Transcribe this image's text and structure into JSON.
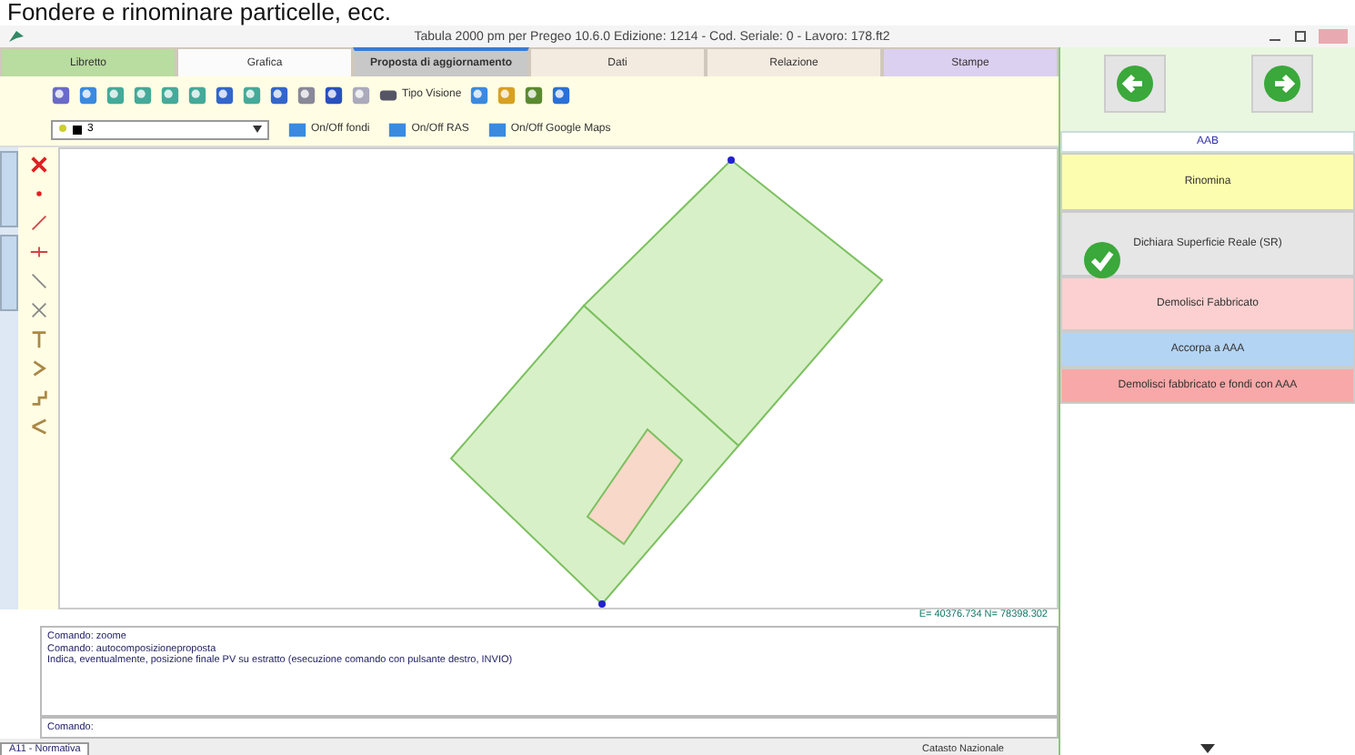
{
  "caption": "Fondere e rinominare particelle, ecc.",
  "window": {
    "title": "Tabula 2000 pm per Pregeo 10.6.0 Edizione: 1214 - Cod. Seriale: 0 - Lavoro: 178.ft2"
  },
  "tabs": [
    {
      "label": "Libretto",
      "selected": false,
      "color": "#b9dca0"
    },
    {
      "label": "Grafica",
      "selected": false,
      "color": "#fbfbfb"
    },
    {
      "label": "Proposta di aggiornamento",
      "selected": true,
      "color": "#c8c8c8"
    },
    {
      "label": "Dati",
      "selected": false,
      "color": "#f4ebe0"
    },
    {
      "label": "Relazione",
      "selected": false,
      "color": "#f4ebe0"
    },
    {
      "label": "Stampe",
      "selected": false,
      "color": "#dcd0f0"
    }
  ],
  "toolbar": {
    "view_button": "Tipo Visione"
  },
  "layer_select": {
    "value": "3"
  },
  "toggles": [
    "On/Off fondi",
    "On/Off RAS",
    "On/Off Google Maps"
  ],
  "coordinates": "E= 40376.734  N= 78398.302",
  "command_log": [
    "Comando:  zoome",
    "Comando:  autocomposizioneproposta",
    "Indica, eventualmente, posizione finale PV su estratto (esecuzione comando con pulsante destro, INVIO)"
  ],
  "command_prompt": "Comando:",
  "bottom_tab": "A11 - Normativa",
  "status": "Catasto Nazionale",
  "side_panel": {
    "header": "AAB",
    "actions": [
      {
        "label": "Rinomina",
        "color": "#fdfdb0"
      },
      {
        "label": "Dichiara Superficie Reale (SR)",
        "color": "#e6e6e6"
      },
      {
        "label": "Demolisci Fabbricato",
        "color": "#fcd0d0"
      },
      {
        "label": "Accorpa a AAA",
        "color": "#b4d4f4"
      },
      {
        "label": "Demolisci fabbricato e fondi con AAA",
        "color": "#f8a8a8"
      }
    ]
  }
}
